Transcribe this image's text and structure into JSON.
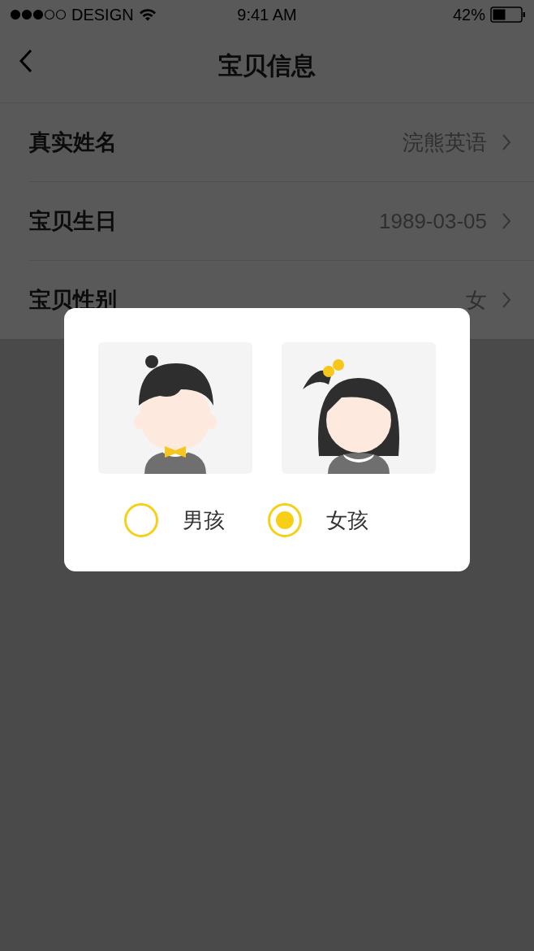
{
  "status_bar": {
    "carrier": "DESIGN",
    "time": "9:41 AM",
    "battery": "42%"
  },
  "nav": {
    "title": "宝贝信息"
  },
  "rows": [
    {
      "label": "真实姓名",
      "value": "浣熊英语"
    },
    {
      "label": "宝贝生日",
      "value": "1989-03-05"
    },
    {
      "label": "宝贝性别",
      "value": "女"
    }
  ],
  "dialog": {
    "options": [
      {
        "kind": "boy",
        "label": "男孩",
        "selected": false
      },
      {
        "kind": "girl",
        "label": "女孩",
        "selected": true
      }
    ]
  }
}
